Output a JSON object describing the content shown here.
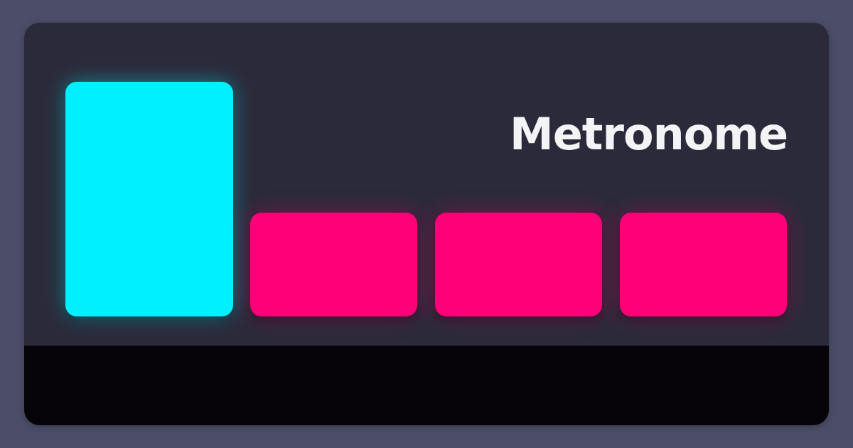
{
  "app": {
    "title": "Metronome"
  },
  "colors": {
    "background": "#4c4d68",
    "panel": "#2b2a3a",
    "accent_beat": "#00f0ff",
    "normal_beat": "#ff0078",
    "footer": "#060409",
    "title_text": "#f4f4f6"
  },
  "beats": [
    {
      "index": 1,
      "type": "accent",
      "active": true,
      "color": "#00f0ff"
    },
    {
      "index": 2,
      "type": "normal",
      "active": false,
      "color": "#ff0078"
    },
    {
      "index": 3,
      "type": "normal",
      "active": false,
      "color": "#ff0078"
    },
    {
      "index": 4,
      "type": "normal",
      "active": false,
      "color": "#ff0078"
    }
  ]
}
